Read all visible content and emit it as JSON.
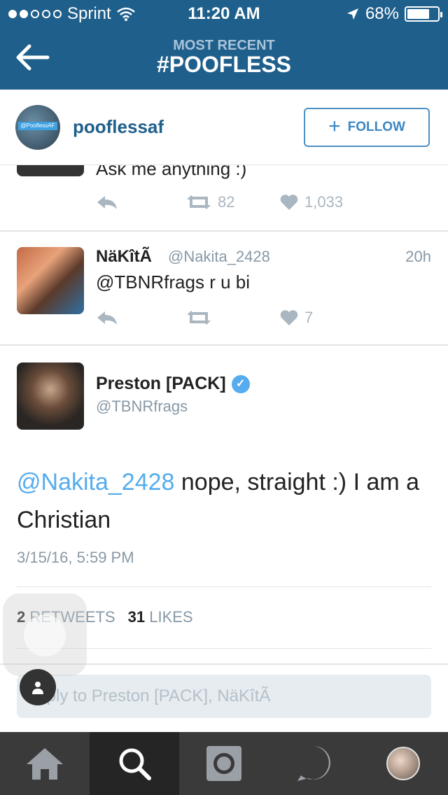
{
  "status": {
    "carrier": "Sprint",
    "time": "11:20 AM",
    "battery_pct": "68%",
    "signal_dots_filled": 2,
    "signal_dots_total": 5
  },
  "nav": {
    "subtitle": "MOST RECENT",
    "title": "#POOFLESS"
  },
  "profile": {
    "username": "pooflessaf",
    "avatar_tag": "@PooflessAF",
    "follow_label": "FOLLOW"
  },
  "tweets": [
    {
      "text": "Ask me anything :)",
      "retweets": "82",
      "likes": "1,033"
    },
    {
      "name": "NäKîtÃ",
      "handle": "@Nakita_2428",
      "time": "20h",
      "text": "@TBNRfrags r u bi",
      "retweets": "",
      "likes": "7"
    }
  ],
  "detail": {
    "name": "Preston [PACK]",
    "handle": "@TBNRfrags",
    "mention": "@Nakita_2428",
    "body": " nope, straight :) I am a Christian",
    "date": "3/15/16, 5:59 PM",
    "retweets_count": "2",
    "retweets_label": "RETWEETS",
    "likes_count": "31",
    "likes_label": "LIKES",
    "reply_placeholder": "Reply to Preston [PACK], NäKîtÃ"
  },
  "colors": {
    "nav_bg": "#1f5f8b",
    "accent": "#55acee",
    "follow": "#3b87c4"
  },
  "tabs": [
    "home-icon",
    "search-icon",
    "camera-icon",
    "activity-icon",
    "profile-avatar"
  ]
}
